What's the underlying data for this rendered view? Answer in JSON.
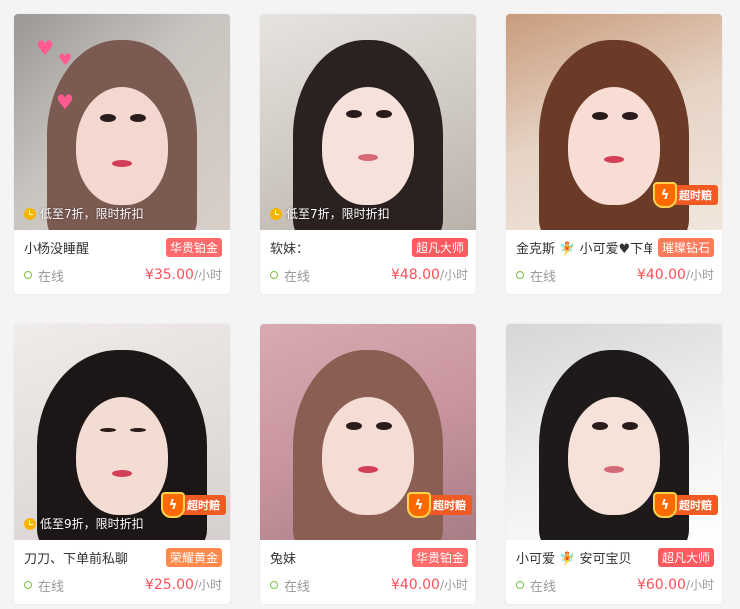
{
  "colors": {
    "badge_platinum": "#ff6b6b",
    "badge_master": "#ff5a5f",
    "badge_diamond": "#ff7a59",
    "badge_gold": "#ff8a4c",
    "price": "#ff4f5a",
    "online_dot": "#7bc043"
  },
  "cards": [
    {
      "name": "小杨没睡醒",
      "badge": "华贵铂金",
      "status": "在线",
      "price": "¥35.00",
      "unit": "/小时",
      "promo": "低至7折，限时折扣",
      "overtime": ""
    },
    {
      "name": "软妹：",
      "badge": "超凡大师",
      "status": "在线",
      "price": "¥48.00",
      "unit": "/小时",
      "promo": "低至7折，限时折扣",
      "overtime": ""
    },
    {
      "name": "金克斯 🧚 小可爱♥下单…",
      "badge": "璀璨钻石",
      "status": "在线",
      "price": "¥40.00",
      "unit": "/小时",
      "promo": "",
      "overtime": "超时赔"
    },
    {
      "name": "刀刀、下单前私聊",
      "badge": "荣耀黄金",
      "status": "在线",
      "price": "¥25.00",
      "unit": "/小时",
      "promo": "低至9折，限时折扣",
      "overtime": "超时赔"
    },
    {
      "name": "兔妹",
      "badge": "华贵铂金",
      "status": "在线",
      "price": "¥40.00",
      "unit": "/小时",
      "promo": "",
      "overtime": "超时赔"
    },
    {
      "name": "小可爱 🧚 安可宝贝",
      "badge": "超凡大师",
      "status": "在线",
      "price": "¥60.00",
      "unit": "/小时",
      "promo": "",
      "overtime": "超时赔"
    }
  ]
}
